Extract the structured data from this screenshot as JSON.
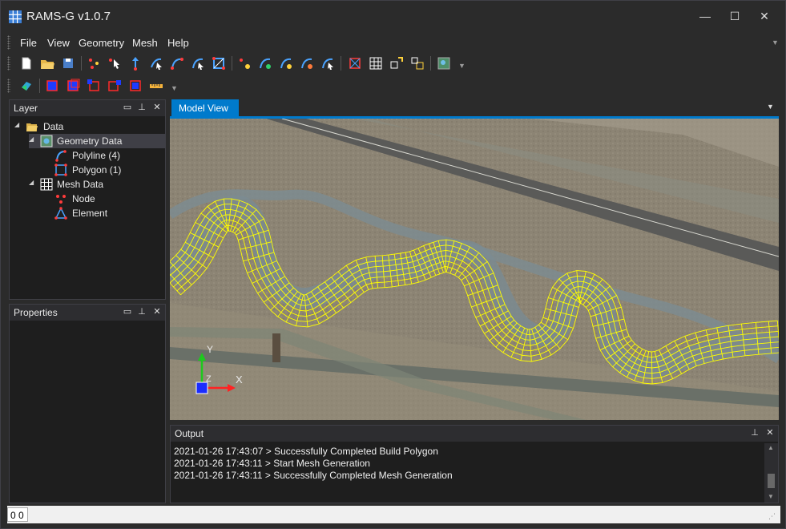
{
  "window": {
    "title": "RAMS-G v1.0.7",
    "minimize": "—",
    "maximize": "☐",
    "close": "✕"
  },
  "menu": {
    "items": [
      "File",
      "View",
      "Geometry",
      "Mesh",
      "Help"
    ]
  },
  "layer_panel": {
    "title": "Layer",
    "tree": [
      {
        "label": "Data",
        "icon": "folder-open-icon",
        "level": 0,
        "expanded": true
      },
      {
        "label": "Geometry Data",
        "icon": "map-layer-icon",
        "level": 1,
        "expanded": true,
        "selected": true
      },
      {
        "label": "Polyline (4)",
        "icon": "polyline-icon",
        "level": 2
      },
      {
        "label": "Polygon (1)",
        "icon": "polygon-icon",
        "level": 2
      },
      {
        "label": "Mesh Data",
        "icon": "mesh-grid-icon",
        "level": 1,
        "expanded": true
      },
      {
        "label": "Node",
        "icon": "node-icon",
        "level": 2
      },
      {
        "label": "Element",
        "icon": "element-icon",
        "level": 2
      }
    ]
  },
  "properties_panel": {
    "title": "Properties"
  },
  "model_view": {
    "tab_label": "Model View",
    "axis_y": "Y",
    "axis_x": "X",
    "axis_z": "Z",
    "mesh_color": "#ffff00"
  },
  "output_panel": {
    "title": "Output",
    "lines": [
      "2021-01-26 17:43:07 > Successfully Completed Build Polygon",
      "2021-01-26 17:43:11 > Start Mesh Generation",
      "2021-01-26 17:43:11 > Successfully Completed Mesh Generation"
    ]
  },
  "status": {
    "text": "0 0"
  },
  "colors": {
    "accent": "#007acc",
    "background": "#2b2b2b",
    "panel": "#1e1e1e"
  }
}
